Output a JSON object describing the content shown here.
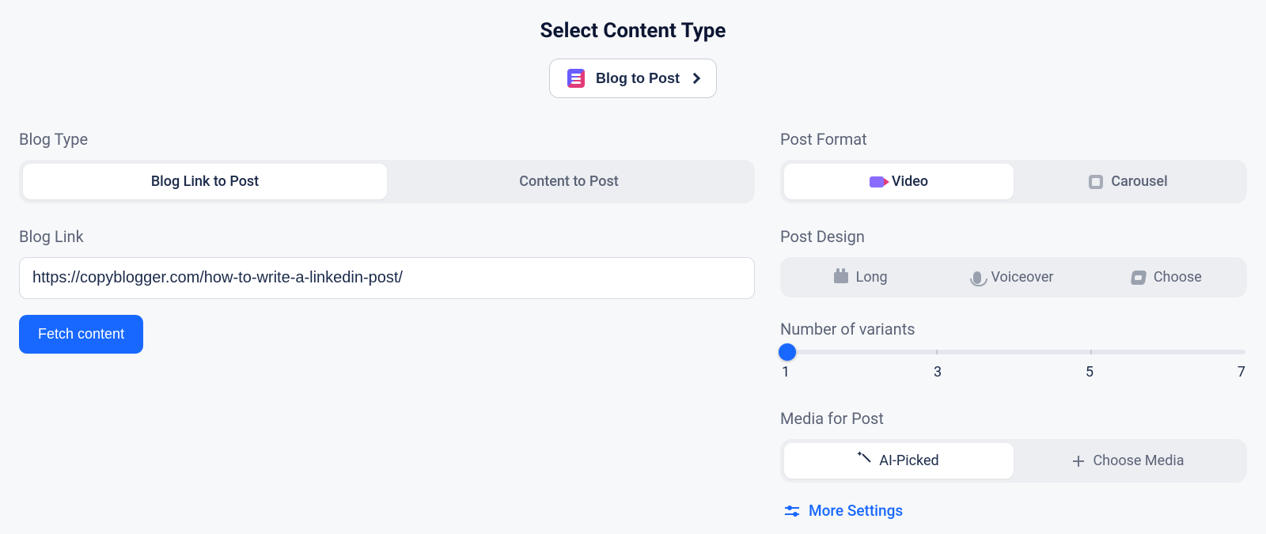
{
  "header": {
    "title": "Select Content Type",
    "content_type_label": "Blog to Post"
  },
  "left": {
    "blog_type_label": "Blog Type",
    "blog_type_options": [
      "Blog Link to Post",
      "Content to Post"
    ],
    "blog_link_label": "Blog Link",
    "blog_link_value": "https://copyblogger.com/how-to-write-a-linkedin-post/",
    "fetch_button": "Fetch content"
  },
  "right": {
    "post_format_label": "Post Format",
    "post_format_options": [
      "Video",
      "Carousel"
    ],
    "post_design_label": "Post Design",
    "post_design_options": [
      "Long",
      "Voiceover",
      "Choose"
    ],
    "variants_label": "Number of variants",
    "variants": {
      "min": 1,
      "mid1": 3,
      "mid2": 5,
      "max": 7,
      "value": 1
    },
    "media_label": "Media for Post",
    "media_options": [
      "AI-Picked",
      "Choose Media"
    ],
    "more_settings": "More Settings"
  }
}
